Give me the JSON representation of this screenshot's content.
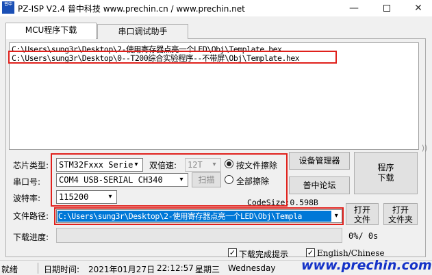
{
  "window": {
    "title": "PZ-ISP V2.4 普中科技 www.prechin.cn / www.prechin.net",
    "icon_text": "普中",
    "min_glyph": "—",
    "close_glyph": "✕"
  },
  "tabs": [
    {
      "label": "MCU程序下载",
      "active": true
    },
    {
      "label": "串口调试助手",
      "active": false
    }
  ],
  "file_list": [
    "C:\\Users\\sung3r\\Desktop\\2-使用寄存器点亮一个LED\\Obj\\Template.hex",
    "C:\\Users\\sung3r\\Desktop\\0--T200综合实验程序--不带屏\\Obj\\Template.hex"
  ],
  "side_arrow": "⟩⟩",
  "form": {
    "chip_type_label": "芯片类型:",
    "chip_type_value": "STM32Fxxx Serie",
    "double_speed_label": "双倍速:",
    "double_speed_value": "12T",
    "erase_by_file_label": "按文件擦除",
    "erase_all_label": "全部擦除",
    "serial_port_label": "串口号:",
    "serial_port_value": "COM4  USB-SERIAL CH340",
    "scan_button": "扫描",
    "baud_label": "波特率:",
    "baud_value": "115200",
    "codesize_label": "CodeSize:",
    "codesize_value": "0.598B",
    "file_path_label": "文件路径:",
    "file_path_value": "C:\\Users\\sung3r\\Desktop\\2-使用寄存器点亮一个LED\\Obj\\Templa",
    "download_progress_label": "下载进度:",
    "progress_percent": 0,
    "progress_text": "0%/ 0s",
    "download_complete_label": "下载完成提示",
    "english_chinese_label": "English/Chinese",
    "check_glyph": "✓",
    "dropdown_glyph": "▾"
  },
  "buttons": {
    "device_manager": "设备管理器",
    "forum": "普中论坛",
    "program_download_line1": "程序",
    "program_download_line2": "下载",
    "open_file_line1": "打开",
    "open_file_line2": "文件",
    "open_folder_line1": "打开",
    "open_folder_line2": "文件夹"
  },
  "statusbar": {
    "status": "就绪",
    "date_label": "日期时间:",
    "date": "2021年01月27日",
    "time": "22:12:57",
    "weekday_cn": "星期三",
    "weekday_en": "Wednesday"
  },
  "watermark": "www.prechin.com",
  "colors": {
    "highlight": "#e0201b",
    "selection": "#0078d7",
    "watermark": "#1432c8"
  }
}
